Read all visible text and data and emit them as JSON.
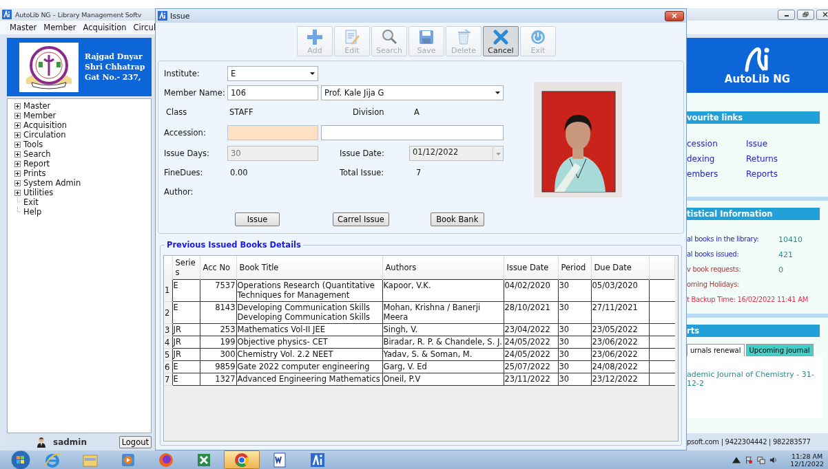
{
  "main_window": {
    "title": "AutoLib NG – Library Management Softv",
    "menu": [
      "Master",
      "Member",
      "Acquisition",
      "Circul"
    ],
    "header_lines": [
      "Rajgad Dnyar",
      "Shri Chhatrap",
      "Gat No.- 237,"
    ],
    "tree": [
      {
        "label": "Master",
        "expandable": true
      },
      {
        "label": "Member",
        "expandable": true
      },
      {
        "label": "Acquisition",
        "expandable": true
      },
      {
        "label": "Circulation",
        "expandable": true
      },
      {
        "label": "Tools",
        "expandable": true
      },
      {
        "label": "Search",
        "expandable": true
      },
      {
        "label": "Report",
        "expandable": true
      },
      {
        "label": "Prints",
        "expandable": true
      },
      {
        "label": "System Admin",
        "expandable": true
      },
      {
        "label": "Utilities",
        "expandable": true
      },
      {
        "label": "Exit",
        "expandable": false
      },
      {
        "label": "Help",
        "expandable": false
      }
    ],
    "user": "sadmin",
    "logout": "Logout"
  },
  "dialog": {
    "title": "Issue",
    "toolbar": [
      {
        "label": "Add",
        "kind": "add",
        "disabled": true,
        "selected": false
      },
      {
        "label": "Edit",
        "kind": "edit",
        "disabled": true,
        "selected": false
      },
      {
        "label": "Search",
        "kind": "search",
        "disabled": true,
        "selected": false
      },
      {
        "label": "Save",
        "kind": "save",
        "disabled": true,
        "selected": false
      },
      {
        "label": "Delete",
        "kind": "delete",
        "disabled": true,
        "selected": false
      },
      {
        "label": "Cancel",
        "kind": "cancel",
        "disabled": false,
        "selected": true
      },
      {
        "label": "Exit",
        "kind": "exit",
        "disabled": true,
        "selected": false
      }
    ],
    "form": {
      "institute_label": "Institute:",
      "institute": "E",
      "member_label": "Member Name:",
      "member_id": "106",
      "member_name": "Prof. Kale Jija G",
      "class_label": "Class",
      "class": "STAFF",
      "division_label": "Division",
      "division": "A",
      "accession_label": "Accession:",
      "accession_focused": true,
      "issue_days_label": "Issue Days:",
      "issue_days": "30",
      "issue_date_label": "Issue Date:",
      "issue_date": "01/12/2022",
      "fine_label": "FineDues:",
      "fine": "0.00",
      "total_label": "Total Issue:",
      "total": "7",
      "author_label": "Author:"
    },
    "buttons": [
      "Issue",
      "Carrel Issue",
      "Book Bank"
    ],
    "history": {
      "title": "Previous Issued Books Details",
      "columns": [
        "Series",
        "Acc No",
        "Book Title",
        "Authors",
        "Issue Date",
        "Period",
        "Due Date"
      ],
      "rows": [
        {
          "number": "1",
          "cells": [
            "E",
            "7537",
            "Operations Research (Quantitative Techniques for Management",
            "Kapoor, V.K.",
            "04/02/2020",
            "30",
            "05/03/2020"
          ]
        },
        {
          "number": "2",
          "cells": [
            "E",
            "8143",
            "Developing Communication Skills Developing Communication Skills",
            "Mohan, Krishna / Banerji Meera",
            "28/10/2021",
            "30",
            "27/11/2021"
          ]
        },
        {
          "number": "3",
          "cells": [
            "JR",
            "253",
            "Mathematics Vol-II JEE",
            "Singh, V.",
            "23/04/2022",
            "30",
            "23/05/2022"
          ]
        },
        {
          "number": "4",
          "cells": [
            "JR",
            "199",
            "Objective physics- CET",
            "Biradar, R. P. & Chandele, S. J.",
            "24/05/2022",
            "30",
            "23/06/2022"
          ]
        },
        {
          "number": "5",
          "cells": [
            "JR",
            "300",
            "Chemistry Vol. 2.2 NEET",
            "Yadav, S. & Soman, M.",
            "24/05/2022",
            "30",
            "23/06/2022"
          ]
        },
        {
          "number": "6",
          "cells": [
            "E",
            "9859",
            "Gate 2022 computer engineering",
            "Garg, V. Ed",
            "25/07/2022",
            "30",
            "24/08/2022"
          ]
        },
        {
          "number": "7",
          "cells": [
            "E",
            "1327",
            "Advanced Engineering Mathematics",
            "Oneil, P.V",
            "23/11/2022",
            "30",
            "23/12/2022"
          ]
        }
      ]
    }
  },
  "right_panel": {
    "brand": "AutoLib NG",
    "favourites": {
      "title": "vourite links",
      "links": [
        "cession",
        "Issue",
        "dexing",
        "Returns",
        "embers",
        "Reports"
      ]
    },
    "stats": {
      "title": "tistical Information",
      "items": [
        {
          "label": "al books in the library:",
          "value": "10410",
          "kind": "count"
        },
        {
          "label": "al books issued:",
          "value": "421",
          "kind": "count"
        },
        {
          "label": "v book requests:",
          "value": "0",
          "kind": "notice"
        },
        {
          "label": "oming Holidays:",
          "kind": "notice"
        },
        {
          "label": "t Backup Time: 16/02/2022 11:41 AM",
          "kind": "alert"
        }
      ]
    },
    "alerts": {
      "title": "rts",
      "tabs": [
        {
          "label": "urnals renewal",
          "selected": true
        },
        {
          "label": "Upcoming journal",
          "selected": false
        }
      ],
      "items": [
        "ademic Journal of Chemistry - 31-12-2"
      ]
    },
    "footer": "psoft.com | 9422304442 | 982283577"
  },
  "taskbar": {
    "apps": [
      {
        "kind": "browser",
        "selected": false
      },
      {
        "kind": "folder",
        "selected": false
      },
      {
        "kind": "media",
        "selected": false
      },
      {
        "kind": "firefox",
        "selected": false
      },
      {
        "kind": "sheet",
        "selected": false
      },
      {
        "kind": "chrome",
        "selected": true
      },
      {
        "kind": "doc",
        "selected": false
      },
      {
        "kind": "autolib",
        "selected": false
      }
    ],
    "time": "11:28 AM",
    "date": "12/1/2022"
  }
}
